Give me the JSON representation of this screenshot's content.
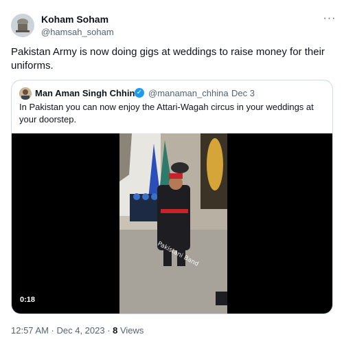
{
  "author": {
    "name": "Koham Soham",
    "handle": "@hamsah_soham"
  },
  "more_icon": "ellipsis-icon",
  "tweet": {
    "text": "Pakistan Army is now doing gigs at weddings to raise money for their uniforms."
  },
  "quoted": {
    "name": "Man Aman Singh Chhina",
    "handle": "@manaman_chhina",
    "separator": "·",
    "date": "Dec 3",
    "verified_icon": "verified-badge-icon",
    "text": "In Pakistan you can now enjoy the Attari-Wagah circus in your weddings at your doorstep.",
    "video": {
      "duration": "0:18",
      "watermark": "Pakistani Band"
    }
  },
  "meta": {
    "time": "12:57 AM · Dec 4, 2023 · ",
    "views_count": "8",
    "views_label": " Views"
  },
  "colors": {
    "accent": "#1d9bf0",
    "secondary_text": "#536471",
    "border": "#cfd9de"
  }
}
